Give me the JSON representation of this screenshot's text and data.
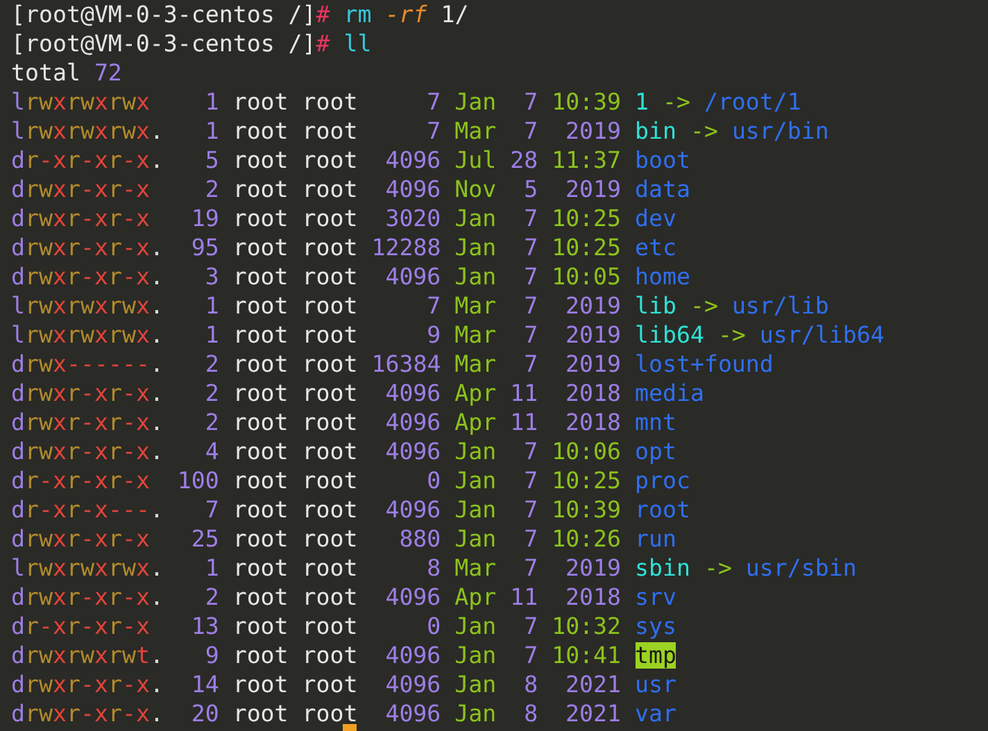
{
  "prompt_lines": [
    {
      "prompt": "[root@VM-0-3-centos /]",
      "symbol": "#",
      "command": "rm",
      "option": "-rf",
      "argument": "1/"
    },
    {
      "prompt": "[root@VM-0-3-centos /]",
      "symbol": "#",
      "command": "ll"
    }
  ],
  "total": {
    "label": "total",
    "value": "72"
  },
  "rows": [
    {
      "perms": "lrwxrwxrwx",
      "links": "1",
      "owner": "root",
      "group": "root",
      "size": "7",
      "month": "Jan",
      "day": "7",
      "time": "10:39",
      "name": "1",
      "kind": "link",
      "arrow": "->",
      "target": "/root/1"
    },
    {
      "perms": "lrwxrwxrwx.",
      "links": "1",
      "owner": "root",
      "group": "root",
      "size": "7",
      "month": "Mar",
      "day": "7",
      "year": "2019",
      "name": "bin",
      "kind": "link",
      "arrow": "->",
      "target": "usr/bin"
    },
    {
      "perms": "dr-xr-xr-x.",
      "links": "5",
      "owner": "root",
      "group": "root",
      "size": "4096",
      "month": "Jul",
      "day": "28",
      "time": "11:37",
      "name": "boot",
      "kind": "dir"
    },
    {
      "perms": "drwxr-xr-x",
      "links": "2",
      "owner": "root",
      "group": "root",
      "size": "4096",
      "month": "Nov",
      "day": "5",
      "year": "2019",
      "name": "data",
      "kind": "dir"
    },
    {
      "perms": "drwxr-xr-x",
      "links": "19",
      "owner": "root",
      "group": "root",
      "size": "3020",
      "month": "Jan",
      "day": "7",
      "time": "10:25",
      "name": "dev",
      "kind": "dir"
    },
    {
      "perms": "drwxr-xr-x.",
      "links": "95",
      "owner": "root",
      "group": "root",
      "size": "12288",
      "month": "Jan",
      "day": "7",
      "time": "10:25",
      "name": "etc",
      "kind": "dir"
    },
    {
      "perms": "drwxr-xr-x.",
      "links": "3",
      "owner": "root",
      "group": "root",
      "size": "4096",
      "month": "Jan",
      "day": "7",
      "time": "10:05",
      "name": "home",
      "kind": "dir"
    },
    {
      "perms": "lrwxrwxrwx.",
      "links": "1",
      "owner": "root",
      "group": "root",
      "size": "7",
      "month": "Mar",
      "day": "7",
      "year": "2019",
      "name": "lib",
      "kind": "link",
      "arrow": "->",
      "target": "usr/lib"
    },
    {
      "perms": "lrwxrwxrwx.",
      "links": "1",
      "owner": "root",
      "group": "root",
      "size": "9",
      "month": "Mar",
      "day": "7",
      "year": "2019",
      "name": "lib64",
      "kind": "link",
      "arrow": "->",
      "target": "usr/lib64"
    },
    {
      "perms": "drwx------.",
      "links": "2",
      "owner": "root",
      "group": "root",
      "size": "16384",
      "month": "Mar",
      "day": "7",
      "year": "2019",
      "name": "lost+found",
      "kind": "dir"
    },
    {
      "perms": "drwxr-xr-x.",
      "links": "2",
      "owner": "root",
      "group": "root",
      "size": "4096",
      "month": "Apr",
      "day": "11",
      "year": "2018",
      "name": "media",
      "kind": "dir"
    },
    {
      "perms": "drwxr-xr-x.",
      "links": "2",
      "owner": "root",
      "group": "root",
      "size": "4096",
      "month": "Apr",
      "day": "11",
      "year": "2018",
      "name": "mnt",
      "kind": "dir"
    },
    {
      "perms": "drwxr-xr-x.",
      "links": "4",
      "owner": "root",
      "group": "root",
      "size": "4096",
      "month": "Jan",
      "day": "7",
      "time": "10:06",
      "name": "opt",
      "kind": "dir"
    },
    {
      "perms": "dr-xr-xr-x",
      "links": "100",
      "owner": "root",
      "group": "root",
      "size": "0",
      "month": "Jan",
      "day": "7",
      "time": "10:25",
      "name": "proc",
      "kind": "dir"
    },
    {
      "perms": "dr-xr-x---.",
      "links": "7",
      "owner": "root",
      "group": "root",
      "size": "4096",
      "month": "Jan",
      "day": "7",
      "time": "10:39",
      "name": "root",
      "kind": "dir"
    },
    {
      "perms": "drwxr-xr-x",
      "links": "25",
      "owner": "root",
      "group": "root",
      "size": "880",
      "month": "Jan",
      "day": "7",
      "time": "10:26",
      "name": "run",
      "kind": "dir"
    },
    {
      "perms": "lrwxrwxrwx.",
      "links": "1",
      "owner": "root",
      "group": "root",
      "size": "8",
      "month": "Mar",
      "day": "7",
      "year": "2019",
      "name": "sbin",
      "kind": "link",
      "arrow": "->",
      "target": "usr/sbin"
    },
    {
      "perms": "drwxr-xr-x.",
      "links": "2",
      "owner": "root",
      "group": "root",
      "size": "4096",
      "month": "Apr",
      "day": "11",
      "year": "2018",
      "name": "srv",
      "kind": "dir"
    },
    {
      "perms": "dr-xr-xr-x",
      "links": "13",
      "owner": "root",
      "group": "root",
      "size": "0",
      "month": "Jan",
      "day": "7",
      "time": "10:32",
      "name": "sys",
      "kind": "dir"
    },
    {
      "perms": "drwxrwxrwt.",
      "links": "9",
      "owner": "root",
      "group": "root",
      "size": "4096",
      "month": "Jan",
      "day": "7",
      "time": "10:41",
      "name": "tmp",
      "kind": "sticky"
    },
    {
      "perms": "drwxr-xr-x.",
      "links": "14",
      "owner": "root",
      "group": "root",
      "size": "4096",
      "month": "Jan",
      "day": "8",
      "year": "2021",
      "name": "usr",
      "kind": "dir"
    },
    {
      "perms": "drwxr-xr-x.",
      "links": "20",
      "owner": "root",
      "group": "root",
      "size": "4096",
      "month": "Jan",
      "day": "8",
      "year": "2021",
      "name": "var",
      "kind": "dir"
    }
  ]
}
